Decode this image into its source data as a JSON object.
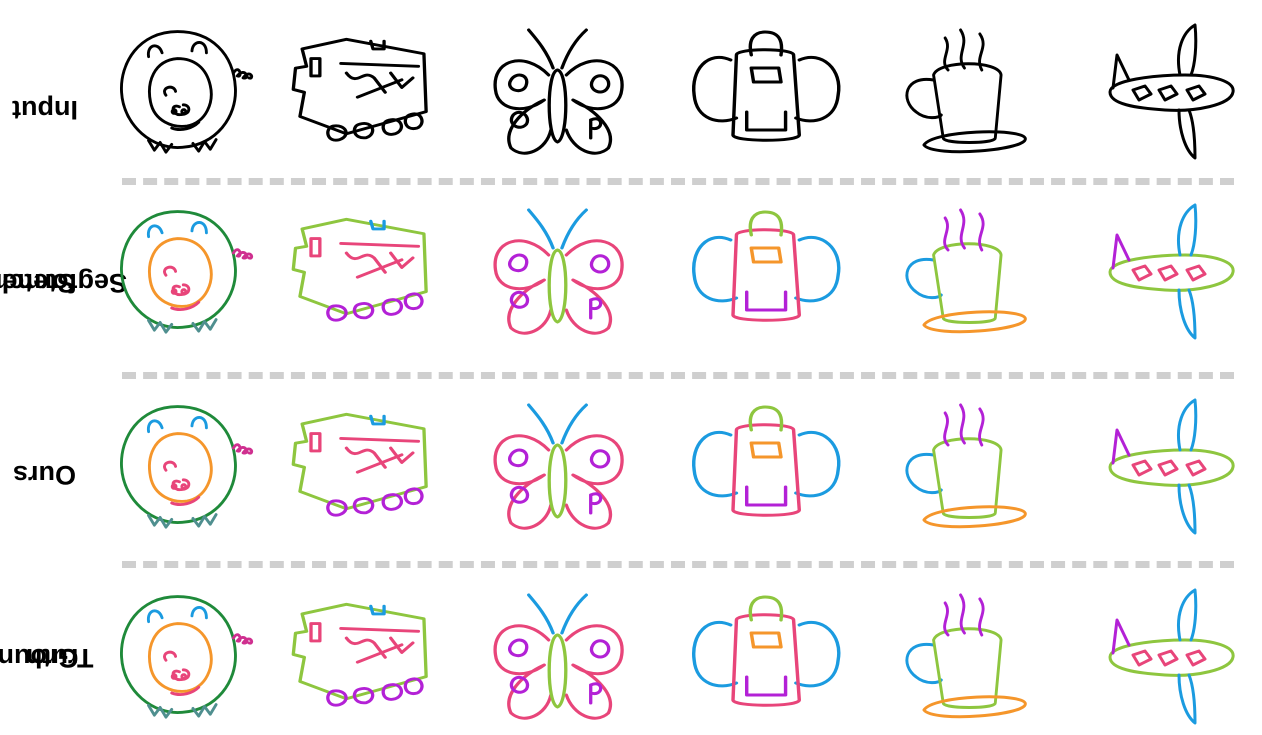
{
  "rows": [
    {
      "label_line1": "Input",
      "label_line2": ""
    },
    {
      "label_line1": "Stetch-",
      "label_line2": "Segformer"
    },
    {
      "label_line1": "Ours",
      "label_line2": ""
    },
    {
      "label_line1": "Ground",
      "label_line2": "Truth"
    }
  ],
  "columns": [
    "pig",
    "train",
    "butterfly",
    "backpack",
    "cup",
    "airplane"
  ],
  "colors": {
    "input": "#000000",
    "green": "#8ec63f",
    "dark_green": "#1f8a3a",
    "blue": "#1b9be0",
    "pink": "#e8457a",
    "purple": "#b321d6",
    "orange": "#f5962b",
    "magenta": "#cf2f8f",
    "teal": "#4f8f8f",
    "divider": "#cfcfcf"
  }
}
